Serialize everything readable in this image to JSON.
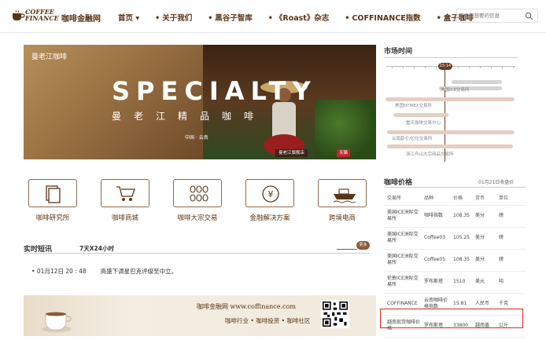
{
  "header": {
    "logo_line1": "COFFEE",
    "logo_line2": "FINANCE",
    "site_name": "咖啡金融网",
    "nav": [
      "首页",
      "关于我们",
      "黑谷子智库",
      "《Roast》杂志",
      "COFFINANCE指数",
      "盒子咖啡"
    ],
    "search_placeholder": "搜索您想要的信息"
  },
  "banner": {
    "brand": "曼老江咖啡",
    "title": "SPECIALTY",
    "subtitle": "曼老江精品咖啡",
    "location": "中国 · 云南",
    "store_tag": "曼老江旗舰店",
    "store_tag_suffix": "天猫"
  },
  "services": [
    "咖啡研究所",
    "咖啡商城",
    "咖啡大宗交易",
    "金融解决方案",
    "跨境电商"
  ],
  "news": {
    "title": "实时短讯",
    "subtitle": "7天X24小时",
    "more": "更多",
    "items": [
      {
        "time": "01月12日 20 : 48",
        "text": "高盛下调星巴克评级至中立。"
      }
    ]
  },
  "ad": {
    "line1": "咖啡金融网 www.coffinance.com",
    "line2": "咖啡行业 • 咖啡投资 • 咖啡社区"
  },
  "market": {
    "title": "市场时间",
    "now": "15:14",
    "sessions": [
      "美国ICE交易所",
      "美国NYMEX交易所",
      "重庆咖啡交易中心",
      "云南勐仑/拉拉交易所",
      "浙江舟山大宗商品交易所"
    ]
  },
  "prices": {
    "title": "咖啡价格",
    "date": "01月21日收盘价",
    "columns": [
      "交易所",
      "品种",
      "价格",
      "货币",
      "单位"
    ],
    "rows": [
      {
        "exchange": "美国ICE洲际交易所",
        "kind": "咖啡指数",
        "price": "108.35",
        "currency": "美分",
        "unit": "磅"
      },
      {
        "exchange": "美国ICE洲际交易所",
        "kind": "Coffee03",
        "price": "105.25",
        "currency": "美分",
        "unit": "磅"
      },
      {
        "exchange": "美国ICE洲际交易所",
        "kind": "Coffee05",
        "price": "108.35",
        "currency": "美分",
        "unit": "磅"
      },
      {
        "exchange": "伦敦ICE洲际交易所",
        "kind": "罗布斯塔",
        "price": "1510",
        "currency": "美元",
        "unit": "吨"
      },
      {
        "exchange": "COFFINANCE",
        "kind": "云南咖啡价格指数",
        "price": "15.81",
        "currency": "人民币",
        "unit": "千克"
      },
      {
        "exchange": "越南现货咖啡价格",
        "kind": "罗布斯塔",
        "price": "33800",
        "currency": "越南盾",
        "unit": "公斤"
      }
    ]
  },
  "colors": {
    "brand": "#5a3416",
    "accent": "#8b5a3c",
    "highlight": "#e32222"
  }
}
